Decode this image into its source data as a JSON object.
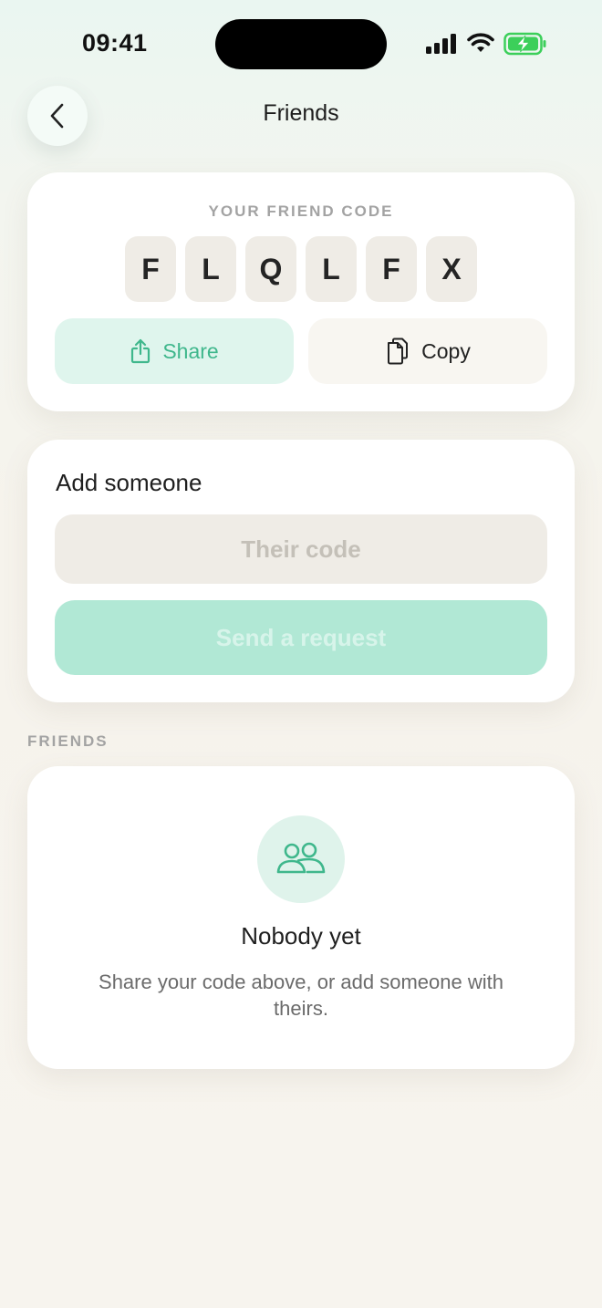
{
  "status_bar": {
    "time": "09:41",
    "icons": [
      "signal-icon",
      "wifi-icon",
      "battery-charging-icon"
    ]
  },
  "header": {
    "back_icon": "chevron-left-icon",
    "title": "Friends"
  },
  "friend_code": {
    "label": "YOUR FRIEND CODE",
    "characters": [
      "F",
      "L",
      "Q",
      "L",
      "F",
      "X"
    ],
    "share_label": "Share",
    "share_icon": "share-icon",
    "copy_label": "Copy",
    "copy_icon": "copy-icon"
  },
  "add_someone": {
    "title": "Add someone",
    "input_value": "",
    "input_placeholder": "Their code",
    "send_label": "Send a request"
  },
  "friends": {
    "section_label": "FRIENDS",
    "empty_icon": "users-icon",
    "empty_title": "Nobody yet",
    "empty_body": "Share your code above, or add someone with theirs."
  },
  "colors": {
    "accent": "#3fb78c",
    "accent_soft": "#dff5ed",
    "send_disabled": "#b1e8d5",
    "tile_bg": "#efece6"
  }
}
